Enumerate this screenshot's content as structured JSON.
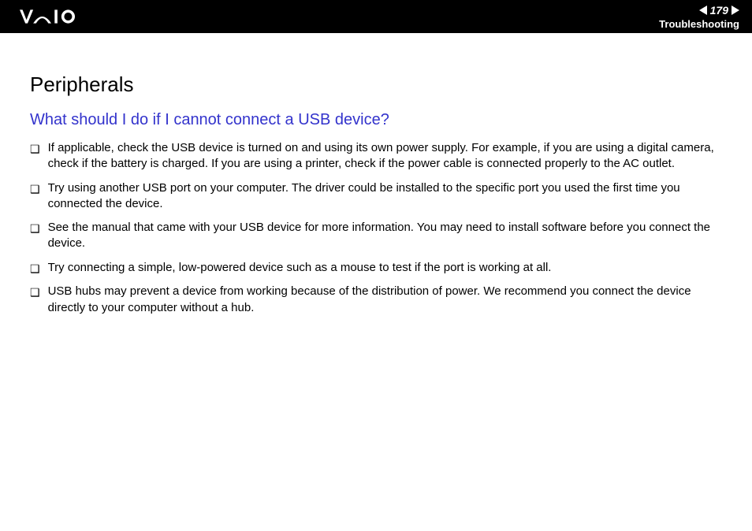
{
  "header": {
    "page_number": "179",
    "section": "Troubleshooting"
  },
  "content": {
    "title": "Peripherals",
    "question": "What should I do if I cannot connect a USB device?",
    "bullets": [
      "If applicable, check the USB device is turned on and using its own power supply. For example, if you are using a digital camera, check if the battery is charged. If you are using a printer, check if the power cable is connected properly to the AC outlet.",
      "Try using another USB port on your computer. The driver could be installed to the specific port you used the first time you connected the device.",
      "See the manual that came with your USB device for more information. You may need to install software before you connect the device.",
      "Try connecting a simple, low-powered device such as a mouse to test if the port is working at all.",
      "USB hubs may prevent a device from working because of the distribution of power. We recommend you connect the device directly to your computer without a hub."
    ]
  }
}
